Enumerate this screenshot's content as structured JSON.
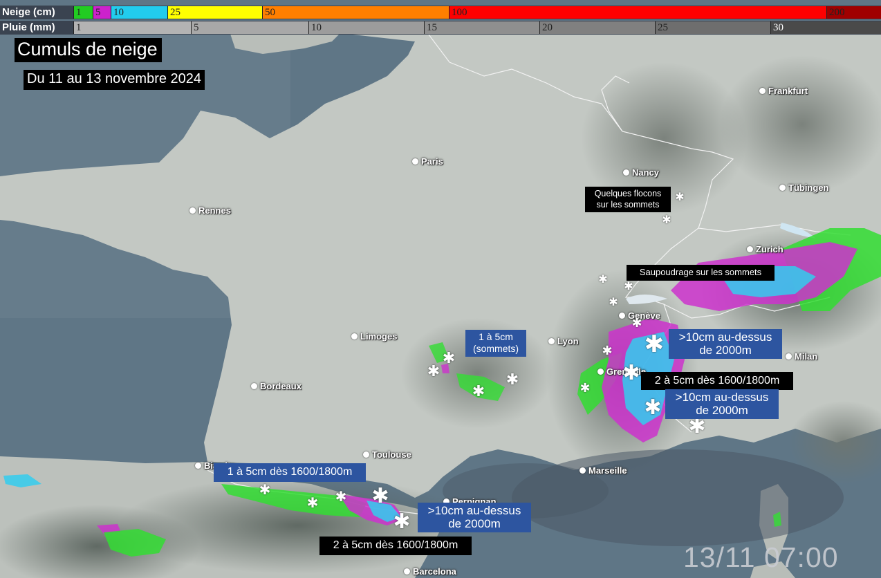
{
  "legend": {
    "snow": {
      "title": "Neige (cm)",
      "segments": [
        {
          "label": "1",
          "color": "#22cc22"
        },
        {
          "label": "5",
          "color": "#cc22cc"
        },
        {
          "label": "10",
          "color": "#22ccee"
        },
        {
          "label": "25",
          "color": "#ffff00"
        },
        {
          "label": "50",
          "color": "#ff7f00"
        },
        {
          "label": "100",
          "color": "#ff0000"
        },
        {
          "label": "200",
          "color": "#a00000"
        }
      ]
    },
    "rain": {
      "title": "Pluie (mm)",
      "segments": [
        {
          "label": "1",
          "color": "#b3b3b3"
        },
        {
          "label": "5",
          "color": "#a8a8a8"
        },
        {
          "label": "10",
          "color": "#9c9c9c"
        },
        {
          "label": "15",
          "color": "#8f8f8f"
        },
        {
          "label": "20",
          "color": "#808080"
        },
        {
          "label": "25",
          "color": "#6e6e6e"
        },
        {
          "label": "30",
          "color": "#4a4a4a"
        }
      ]
    }
  },
  "title": "Cumuls de neige",
  "subtitle": "Du 11 au 13 novembre 2024",
  "timestamp": "13/11 07:00",
  "cities": [
    {
      "name": "Frankfurt"
    },
    {
      "name": "Paris"
    },
    {
      "name": "Nancy"
    },
    {
      "name": "Tübingen"
    },
    {
      "name": "Rennes"
    },
    {
      "name": "Zurich"
    },
    {
      "name": "Genève"
    },
    {
      "name": "Limoges"
    },
    {
      "name": "Lyon"
    },
    {
      "name": "Milan"
    },
    {
      "name": "Grenoble"
    },
    {
      "name": "Bordeaux"
    },
    {
      "name": "Toulouse"
    },
    {
      "name": "Biarritz"
    },
    {
      "name": "Marseille"
    },
    {
      "name": "Perpignan"
    },
    {
      "name": "Barcelona"
    }
  ],
  "annotations": [
    {
      "text_lines": [
        "Quelques flocons",
        "sur les sommets"
      ],
      "style": "black"
    },
    {
      "text_lines": [
        "Saupoudrage sur les sommets"
      ],
      "style": "black"
    },
    {
      "text_lines": [
        "1 à 5cm",
        "(sommets)"
      ],
      "style": "blue"
    },
    {
      "text_lines": [
        ">10cm au-dessus",
        "de 2000m"
      ],
      "style": "blue"
    },
    {
      "text_lines": [
        "2 à 5cm dès 1600/1800m"
      ],
      "style": "black"
    },
    {
      "text_lines": [
        ">10cm au-dessus",
        "de 2000m"
      ],
      "style": "blue"
    },
    {
      "text_lines": [
        "1 à 5cm dès 1600/1800m"
      ],
      "style": "blue"
    },
    {
      "text_lines": [
        ">10cm au-dessus",
        "de 2000m"
      ],
      "style": "blue"
    },
    {
      "text_lines": [
        "2 à 5cm dès 1600/1800m"
      ],
      "style": "black"
    }
  ],
  "colors": {
    "sea": "#5f7686",
    "land": "#c2c7c2",
    "snow_green": "#33dd33",
    "snow_magenta": "#cc33cc",
    "snow_cyan": "#33ccee",
    "label_blue": "#2d55a0",
    "label_black": "#000000"
  }
}
